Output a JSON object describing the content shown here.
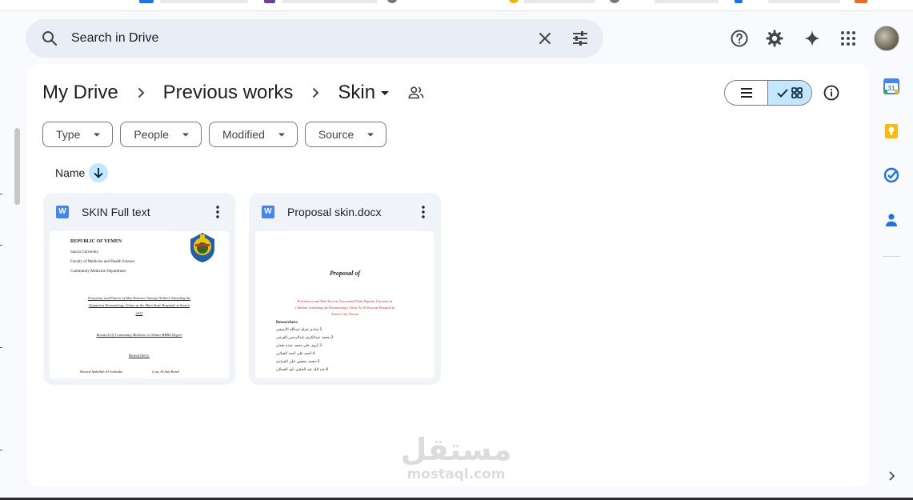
{
  "search": {
    "placeholder": "Search in Drive"
  },
  "breadcrumb": {
    "items": [
      "My Drive",
      "Previous works",
      "Skin"
    ]
  },
  "filters": [
    "Type",
    "People",
    "Modified",
    "Source"
  ],
  "sort": {
    "label": "Name"
  },
  "files": [
    {
      "title": "SKIN Full text",
      "type_badge": "W",
      "preview": {
        "header": [
          "REPUBLIC OF YEMEN",
          "Sana'a University",
          "Faculty of Medicine and Health Science",
          "Community Medicine Department"
        ],
        "title_lines": [
          "Frequency and Pattern of Skin Diseases Among Children Attending the",
          "Outpatient Dermatology Clinics at the Main State Hospitals in Sana'a",
          "2023"
        ],
        "subtitle": "Research Of Community Medicine to Obtain MBBS Degree",
        "researchers_label": "Researchers:",
        "names": [
          "Hamed Abdullah Al-Gabsabe",
          "Loay Al-Saif Rateb"
        ]
      }
    },
    {
      "title": "Proposal skin.docx",
      "type_badge": "W",
      "preview": {
        "heading": "Proposal of",
        "red_lines": [
          "Prevalence and Risk Factors Associated With Papular Urticaria in",
          "Children Attending the Dermatology Clinic At Al-Kuwait Hospital in",
          "Sana'a City Yemen"
        ],
        "researchers_label": "Researchers:",
        "names": [
          "1-شادي حزام عبدالله الأصبحي",
          "2-محمد عبدالكريم عبدالرحمن الفرحي",
          "3-أروى علي محمد عبده نعمان",
          "4-أحمد علي أحمد القبلاني",
          "5-محمد محسن علي الجرادي",
          "6-عبد الله عبد الحكيم داود الجمالي"
        ]
      }
    }
  ],
  "watermark": {
    "arabic": "مستقل",
    "latin": "mostaql.com"
  },
  "colors": {
    "background": "#f8fafd",
    "search_bg": "#e9eef6",
    "selected": "#c2e7ff",
    "card_bg": "#f0f4f9",
    "word_blue": "#4285f4"
  }
}
